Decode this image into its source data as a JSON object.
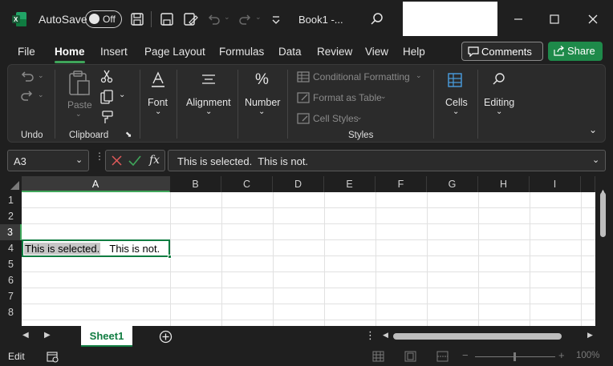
{
  "titlebar": {
    "autosave_label": "AutoSave",
    "autosave_state": "Off",
    "doc_title": "Book1  -...",
    "icons": [
      "excel-logo",
      "save-icon",
      "save-as-icon",
      "edit-icon",
      "undo-icon",
      "redo-icon",
      "customize-icon",
      "search-icon",
      "minimize-icon",
      "maximize-icon",
      "close-icon"
    ]
  },
  "tabs": [
    "File",
    "Home",
    "Insert",
    "Page Layout",
    "Formulas",
    "Data",
    "Review",
    "View",
    "Help"
  ],
  "active_tab": "Home",
  "actions": {
    "comments": "Comments",
    "share": "Share"
  },
  "ribbon": {
    "undo_group": "Undo",
    "clipboard_group": "Clipboard",
    "paste": "Paste",
    "font": "Font",
    "alignment": "Alignment",
    "number": "Number",
    "conditional_formatting": "Conditional Formatting",
    "format_as_table": "Format as Table",
    "cell_styles": "Cell Styles",
    "styles_group": "Styles",
    "cells": "Cells",
    "editing": "Editing"
  },
  "formula_bar": {
    "name_box": "A3",
    "fx": "fx",
    "content": "This is selected.  This is not."
  },
  "grid": {
    "columns": [
      "A",
      "B",
      "C",
      "D",
      "E",
      "F",
      "G",
      "H",
      "I"
    ],
    "rows": [
      "1",
      "2",
      "3",
      "4",
      "5",
      "6",
      "7",
      "8"
    ],
    "selected_column": "A",
    "cell_a3_selected": "This is selected.",
    "cell_a3_rest": " This is not."
  },
  "sheet_tabs": [
    "Sheet1"
  ],
  "status": {
    "mode": "Edit",
    "zoom": "100%"
  },
  "colors": {
    "accent": "#107c41",
    "share": "#1e8a4a",
    "background": "#1f1f1f"
  }
}
